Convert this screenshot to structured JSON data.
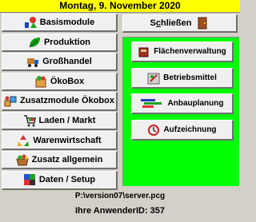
{
  "header": {
    "date": "Montag, 9. November 2020"
  },
  "left_menu": [
    {
      "label": "Basismodule",
      "icon": "chart-shapes-icon"
    },
    {
      "label": "Produktion",
      "icon": "leaf-icon"
    },
    {
      "label": "Großhandel",
      "icon": "truck-icon"
    },
    {
      "label": "ÖkoBox",
      "icon": "box-icon"
    },
    {
      "label": "Zusatzmodule Ökobox",
      "icon": "boxes-icon"
    },
    {
      "label": "Laden / Markt",
      "icon": "shopping-cart-icon"
    },
    {
      "label": "Warenwirtschaft",
      "icon": "recycle-icon"
    },
    {
      "label": "Zusatz allgemein",
      "icon": "basket-icon"
    },
    {
      "label": "Daten / Setup",
      "icon": "database-icon"
    }
  ],
  "close_button": {
    "label_prefix": "S",
    "label_underlined": "c",
    "label_rest": "hließen",
    "icon": "exit-door-icon"
  },
  "sub_menu": [
    {
      "label": "Flächenverwaltung",
      "icon": "field-book-icon"
    },
    {
      "label": "Betriebsmittel",
      "icon": "supplies-icon"
    },
    {
      "label": "Anbauplanung",
      "icon": "planning-bars-icon"
    },
    {
      "label": "Aufzeichnung",
      "icon": "recording-icon"
    }
  ],
  "footer": {
    "path": "P:\\version07\\server.pcg",
    "user_id": "Ihre AnwenderID: 357"
  },
  "colors": {
    "date_bar": "#ffff00",
    "panel": "#00ff00",
    "button_face": "#f0f0f0"
  }
}
